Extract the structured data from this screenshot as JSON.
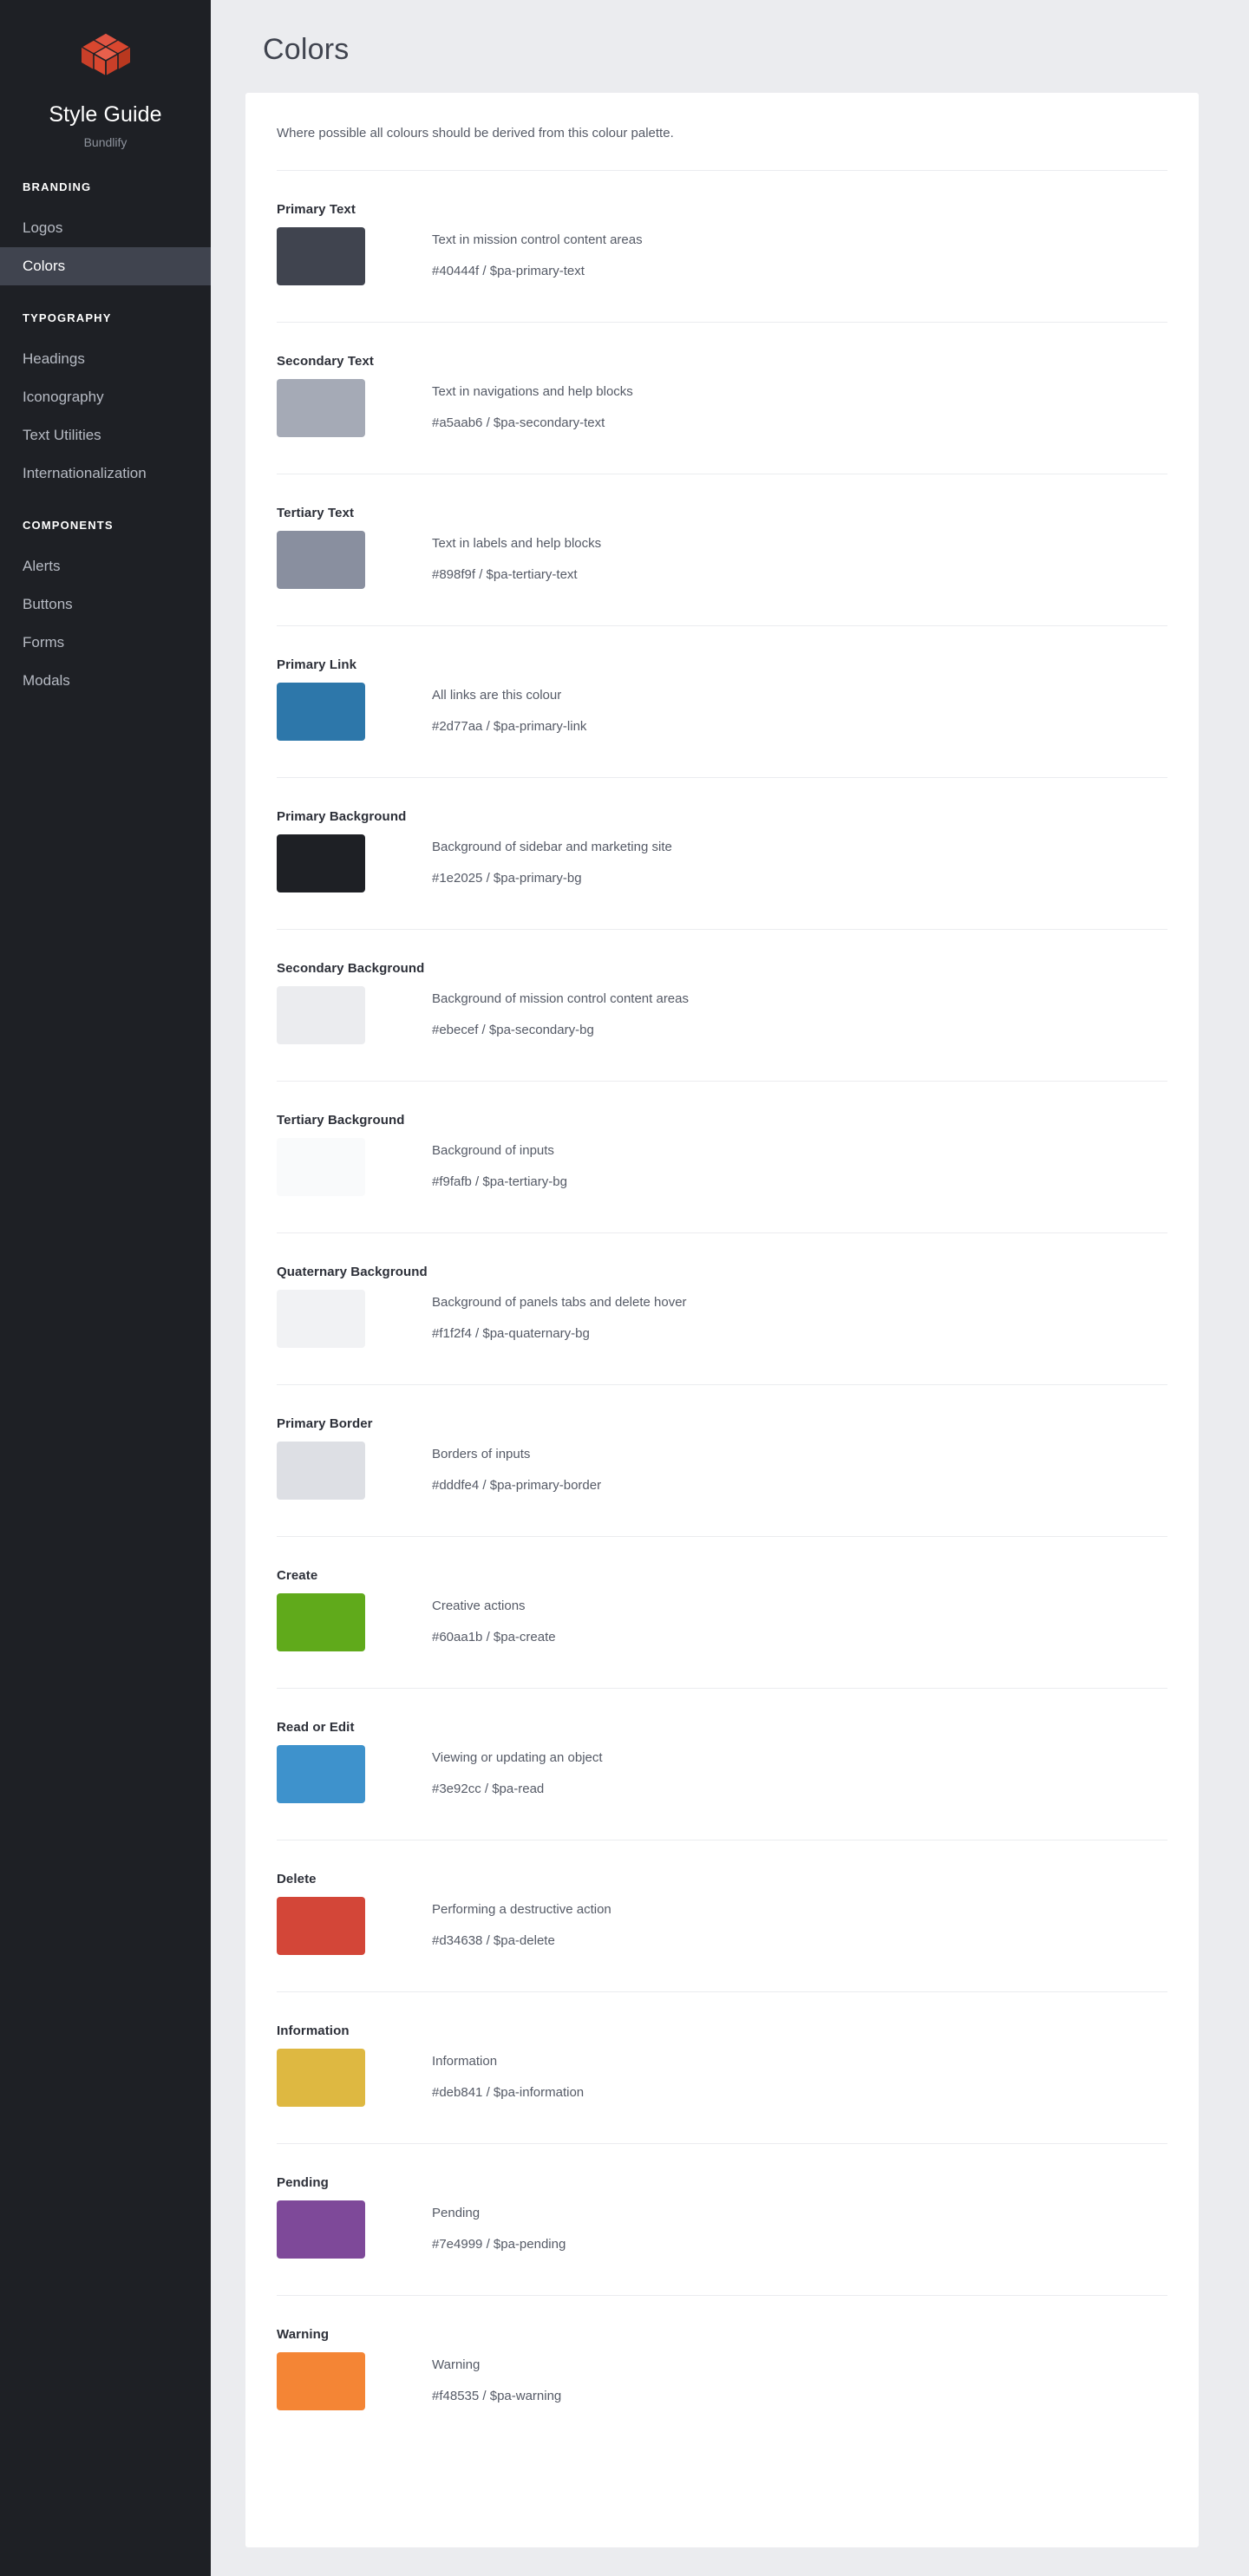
{
  "sidebar": {
    "logo_icon": "cube-logo-icon",
    "brand_title": "Style Guide",
    "brand_subtitle": "Bundlify",
    "sections": [
      {
        "label": "BRANDING",
        "items": [
          {
            "label": "Logos",
            "active": false
          },
          {
            "label": "Colors",
            "active": true
          }
        ]
      },
      {
        "label": "TYPOGRAPHY",
        "items": [
          {
            "label": "Headings",
            "active": false
          },
          {
            "label": "Iconography",
            "active": false
          },
          {
            "label": "Text Utilities",
            "active": false
          },
          {
            "label": "Internationalization",
            "active": false
          }
        ]
      },
      {
        "label": "COMPONENTS",
        "items": [
          {
            "label": "Alerts",
            "active": false
          },
          {
            "label": "Buttons",
            "active": false
          },
          {
            "label": "Forms",
            "active": false
          },
          {
            "label": "Modals",
            "active": false
          }
        ]
      }
    ]
  },
  "main": {
    "page_title": "Colors",
    "intro": "Where possible all colours should be derived from this colour palette.",
    "swatches": [
      {
        "name": "Primary Text",
        "description": "Text in mission control content areas",
        "hex": "#40444f",
        "variable": "$pa-primary-text",
        "label": "#40444f / $pa-primary-text"
      },
      {
        "name": "Secondary Text",
        "description": "Text in navigations and help blocks",
        "hex": "#a5aab6",
        "variable": "$pa-secondary-text",
        "label": "#a5aab6 / $pa-secondary-text"
      },
      {
        "name": "Tertiary Text",
        "description": "Text in labels and help blocks",
        "hex": "#898f9f",
        "variable": "$pa-tertiary-text",
        "label": "#898f9f / $pa-tertiary-text"
      },
      {
        "name": "Primary Link",
        "description": "All links are this colour",
        "hex": "#2d77aa",
        "variable": "$pa-primary-link",
        "label": "#2d77aa / $pa-primary-link"
      },
      {
        "name": "Primary Background",
        "description": "Background of sidebar and marketing site",
        "hex": "#1e2025",
        "variable": "$pa-primary-bg",
        "label": "#1e2025 / $pa-primary-bg"
      },
      {
        "name": "Secondary Background",
        "description": "Background of mission control content areas",
        "hex": "#ebecef",
        "variable": "$pa-secondary-bg",
        "label": "#ebecef / $pa-secondary-bg"
      },
      {
        "name": "Tertiary Background",
        "description": "Background of inputs",
        "hex": "#f9fafb",
        "variable": "$pa-tertiary-bg",
        "label": "#f9fafb / $pa-tertiary-bg"
      },
      {
        "name": "Quaternary Background",
        "description": "Background of panels tabs and delete hover",
        "hex": "#f1f2f4",
        "variable": "$pa-quaternary-bg",
        "label": "#f1f2f4 / $pa-quaternary-bg"
      },
      {
        "name": "Primary Border",
        "description": "Borders of inputs",
        "hex": "#dddfe4",
        "variable": "$pa-primary-border",
        "label": "#dddfe4 / $pa-primary-border"
      },
      {
        "name": "Create",
        "description": "Creative actions",
        "hex": "#60aa1b",
        "variable": "$pa-create",
        "label": "#60aa1b / $pa-create"
      },
      {
        "name": "Read or Edit",
        "description": "Viewing or updating an object",
        "hex": "#3e92cc",
        "variable": "$pa-read",
        "label": "#3e92cc / $pa-read"
      },
      {
        "name": "Delete",
        "description": "Performing a destructive action",
        "hex": "#d34638",
        "variable": "$pa-delete",
        "label": "#d34638 / $pa-delete"
      },
      {
        "name": "Information",
        "description": "Information",
        "hex": "#deb841",
        "variable": "$pa-information",
        "label": "#deb841 / $pa-information"
      },
      {
        "name": "Pending",
        "description": "Pending",
        "hex": "#7e4999",
        "variable": "$pa-pending",
        "label": "#7e4999 / $pa-pending"
      },
      {
        "name": "Warning",
        "description": "Warning",
        "hex": "#f48535",
        "variable": "$pa-warning",
        "label": "#f48535 / $pa-warning"
      }
    ]
  },
  "theme": {
    "sidebar_bg": "#1e2025",
    "sidebar_active_bg": "#40444f",
    "content_bg": "#ebecef",
    "panel_bg": "#ffffff",
    "divider": "#ebecef",
    "logo_red": "#d9472f"
  }
}
